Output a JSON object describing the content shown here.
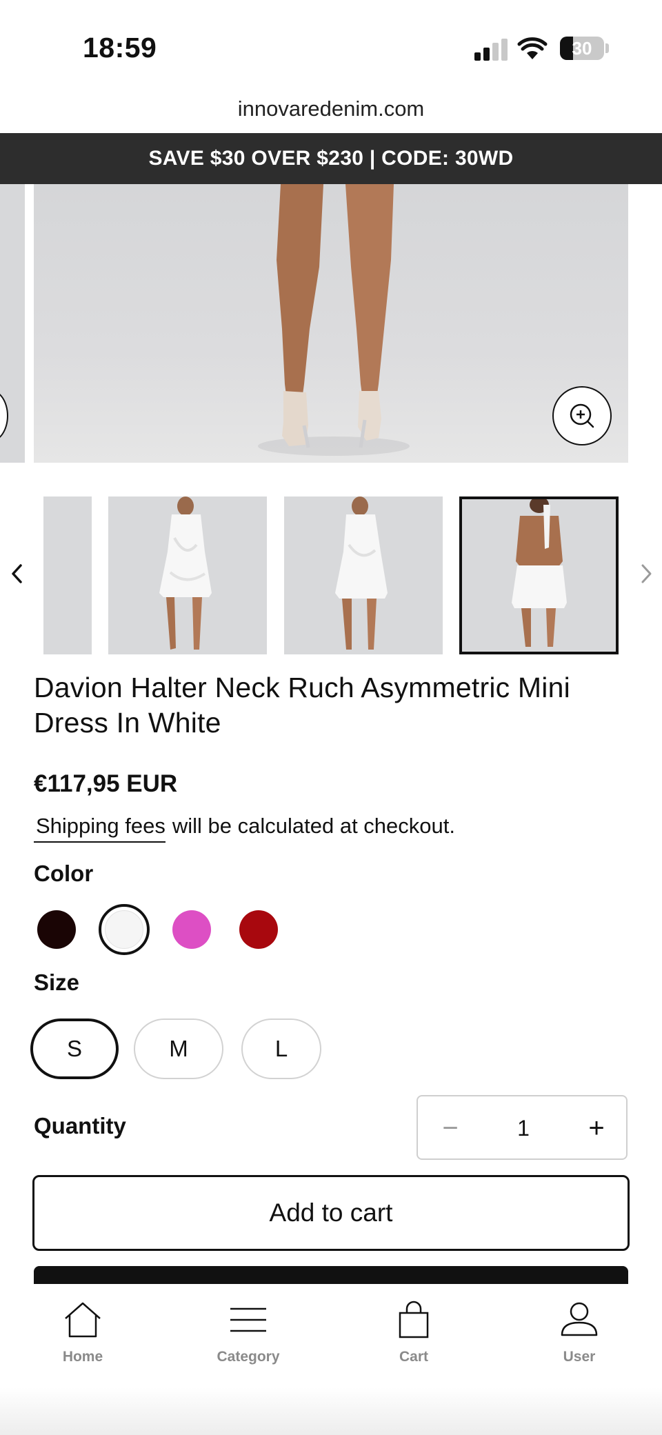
{
  "status": {
    "time": "18:59",
    "battery": "30"
  },
  "browser": {
    "url": "innovaredenim.com"
  },
  "promo": {
    "text": "SAVE $30 OVER $230 | CODE:  30WD"
  },
  "product": {
    "title": "Davion Halter Neck Ruch Asymmetric Mini Dress In White",
    "price": "€117,95 EUR",
    "shipping_link": "Shipping fees",
    "shipping_text": "will be calculated at checkout."
  },
  "color": {
    "label": "Color",
    "swatches": [
      "#1a0505",
      "#f5f5f5",
      "#dd4fc4",
      "#a8080e"
    ],
    "selected_index": 1
  },
  "size": {
    "label": "Size",
    "options": [
      "S",
      "M",
      "L"
    ],
    "selected": "S"
  },
  "quantity": {
    "label": "Quantity",
    "value": "1",
    "minus": "−",
    "plus": "+"
  },
  "actions": {
    "add_to_cart": "Add to cart"
  },
  "nav": {
    "home": "Home",
    "category": "Category",
    "cart": "Cart",
    "user": "User"
  }
}
